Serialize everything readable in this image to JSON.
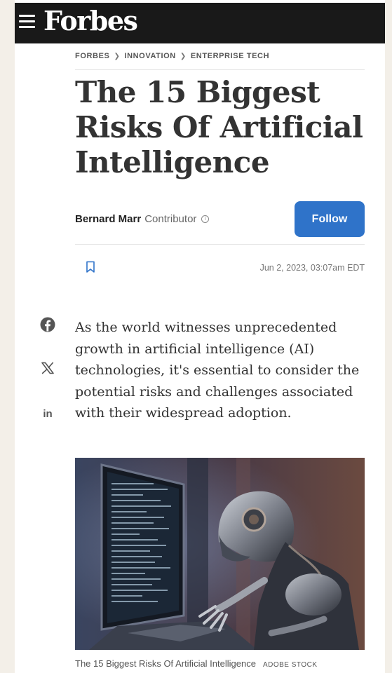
{
  "header": {
    "logo": "Forbes"
  },
  "breadcrumb": [
    "FORBES",
    "INNOVATION",
    "ENTERPRISE TECH"
  ],
  "article": {
    "headline": "The 15 Biggest Risks Of Artificial Intelligence",
    "author": "Bernard Marr",
    "role": "Contributor",
    "follow_label": "Follow",
    "date": "Jun 2, 2023, 03:07am EDT",
    "lead": "As the world witnesses unprecedented growth in artificial intelligence (AI) technologies, it's essential to consider the potential risks and challenges associated with their widespread adoption.",
    "image_caption": "The 15 Biggest Risks Of Artificial Intelligence",
    "image_credit": "ADOBE STOCK"
  },
  "colors": {
    "topbar": "#191919",
    "follow_button": "#2f73c9"
  },
  "icons": [
    "menu-icon",
    "bookmark-icon",
    "facebook-icon",
    "x-icon",
    "linkedin-icon",
    "info-icon"
  ]
}
